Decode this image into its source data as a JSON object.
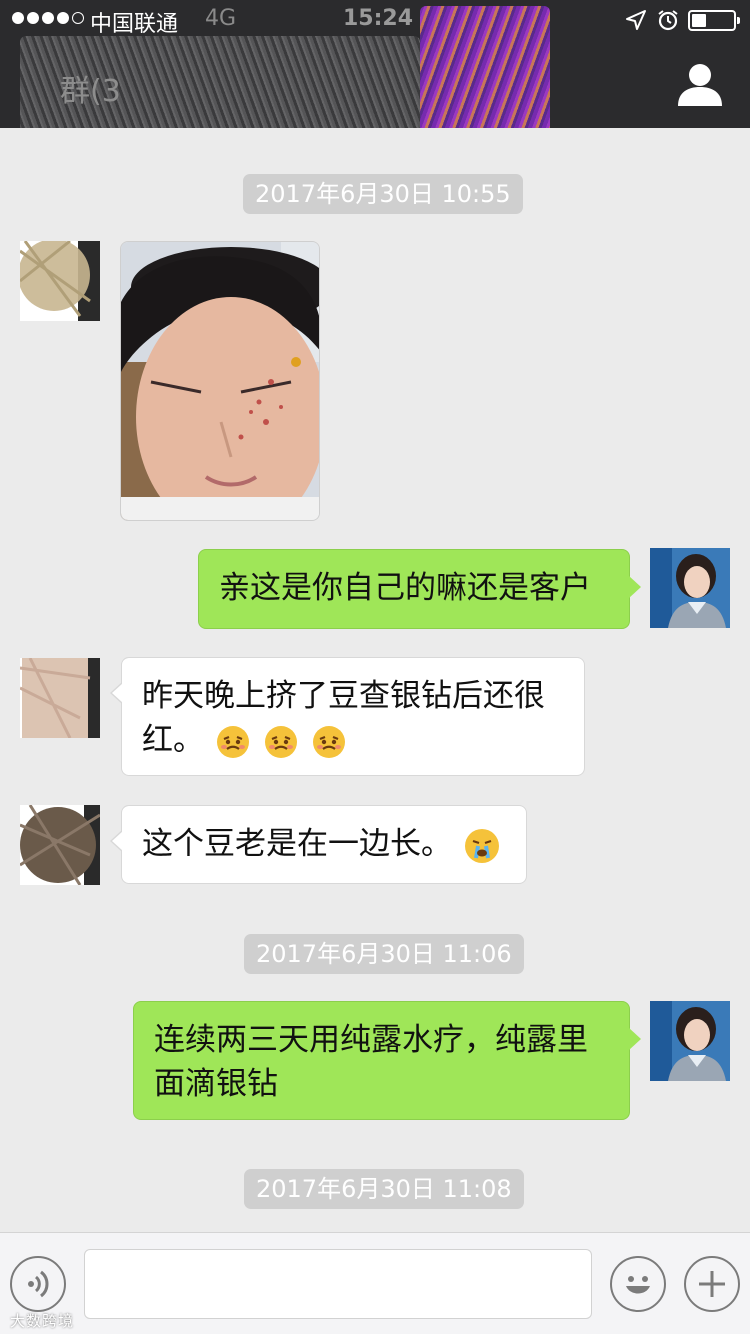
{
  "status_bar": {
    "carrier": "中国联通",
    "network": "4G",
    "time": "15:24"
  },
  "nav": {
    "title": "群(3",
    "right_icon": "person-icon"
  },
  "messages": [
    {
      "type": "timestamp",
      "text": "2017年6月30日 10:55"
    },
    {
      "type": "image",
      "direction": "in"
    },
    {
      "type": "text",
      "direction": "out",
      "lines": [
        "亲这是你自己的嘛还是客户"
      ]
    },
    {
      "type": "text",
      "direction": "in",
      "lines": [
        "昨天晚上挤了豆查银钻后还很",
        "红。"
      ],
      "emoji": [
        "grimace-emoji",
        "grimace-emoji",
        "grimace-emoji"
      ]
    },
    {
      "type": "text",
      "direction": "in",
      "lines": [
        "这个豆老是在一边长。"
      ],
      "emoji": [
        "crying-emoji"
      ]
    },
    {
      "type": "timestamp",
      "text": "2017年6月30日 11:06"
    },
    {
      "type": "text",
      "direction": "out",
      "lines": [
        "连续两三天用纯露水疗，纯露里",
        "面滴银钻"
      ]
    },
    {
      "type": "timestamp",
      "text": "2017年6月30日 11:08"
    }
  ],
  "input_bar": {
    "voice_icon": "voice-icon",
    "emoji_icon": "emoji-icon",
    "plus_icon": "plus-icon",
    "value": ""
  },
  "watermark": "大数跨境",
  "colors": {
    "chat_background": "#ebebeb",
    "bubble_outgoing": "#9fe658",
    "bubble_incoming": "#ffffff",
    "top_bar": "#2b2b2d",
    "timestamp_pill": "#cfcfcf"
  }
}
